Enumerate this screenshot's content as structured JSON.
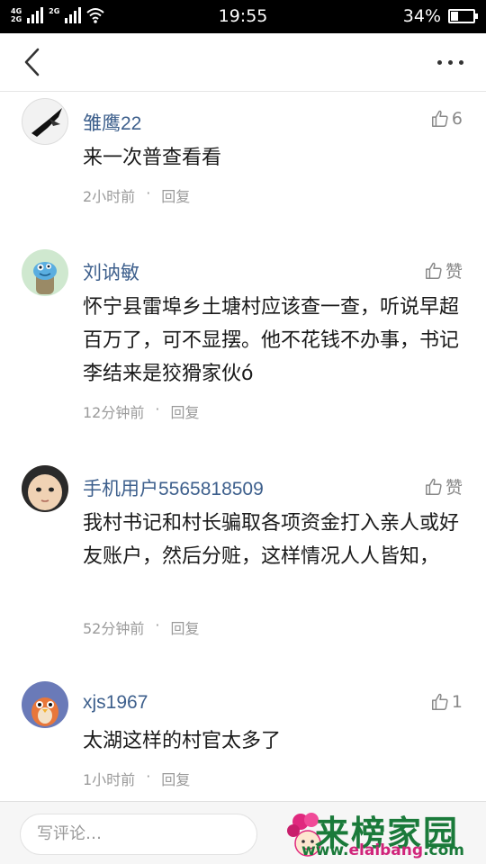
{
  "status_bar": {
    "network_top": "4G",
    "network_bottom": "2G",
    "network_2": "2G",
    "time": "19:55",
    "battery_percent": "34%",
    "battery_level": 0.34
  },
  "nav": {
    "back_icon": "chevron-left-icon",
    "more_icon": "more-horizontal-icon"
  },
  "comments": [
    {
      "name": "雏鹰22",
      "like_label": "6",
      "text": "来一次普查看看",
      "time": "2小时前",
      "reply": "回复"
    },
    {
      "name": "刘讷敏",
      "like_label": "赞",
      "text": "怀宁县雷埠乡土塘村应该查一查，听说早超百万了，可不显摆。他不花钱不办事，书记李结来是狡猾家伙ó",
      "time": "12分钟前",
      "reply": "回复"
    },
    {
      "name": "手机用户5565818509",
      "like_label": "赞",
      "text": "我村书记和村长骗取各项资金打入亲人或好友账户，然后分赃，这样情况人人皆知，",
      "time": "52分钟前",
      "reply": "回复"
    },
    {
      "name": "xjs1967",
      "like_label": "1",
      "text": "太湖这样的村官太多了",
      "time": "1小时前",
      "reply": "回复"
    }
  ],
  "bottom_bar": {
    "input_placeholder": "写评论…",
    "watermark_title": "来榜家园",
    "watermark_url_prefix": "www.",
    "watermark_url_brand": "elaibang",
    "watermark_url_suffix": ".com"
  },
  "colors": {
    "name": "#3d5f8c",
    "meta": "#9a9a9a",
    "watermark_green": "#1a7a3a",
    "watermark_pink": "#d0247a"
  }
}
